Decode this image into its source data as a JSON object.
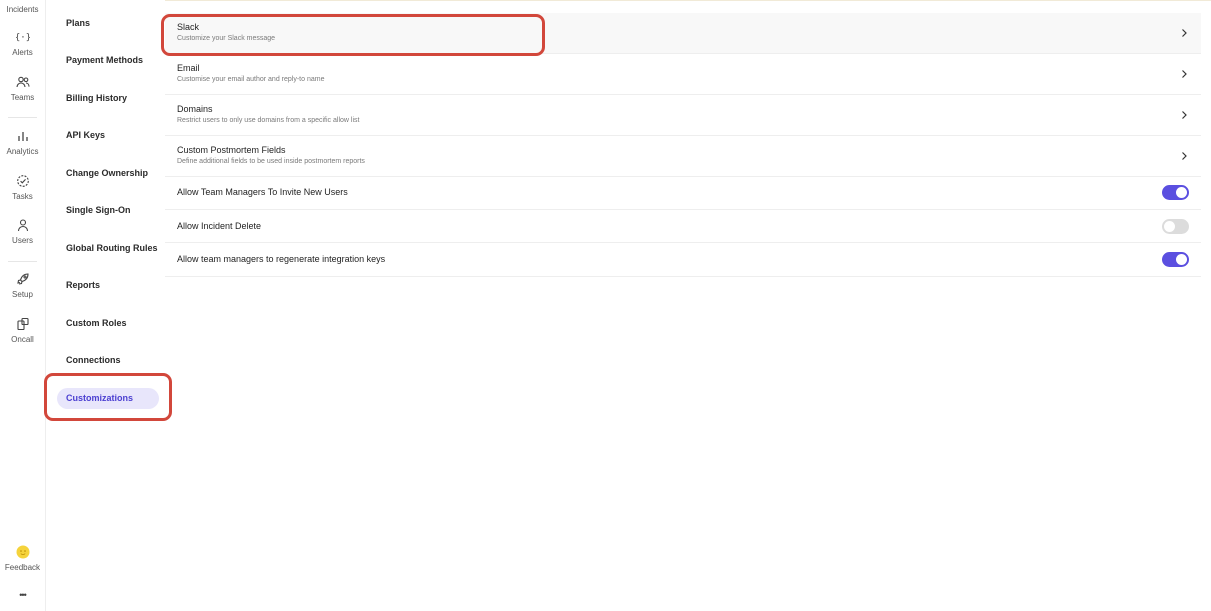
{
  "rail": {
    "items": [
      {
        "label": "Incidents",
        "icon": "incidents-icon"
      },
      {
        "label": "Alerts",
        "icon": "alerts-icon"
      },
      {
        "label": "Teams",
        "icon": "teams-icon"
      },
      {
        "label": "Analytics",
        "icon": "analytics-icon"
      },
      {
        "label": "Tasks",
        "icon": "tasks-icon"
      },
      {
        "label": "Users",
        "icon": "user-icon"
      },
      {
        "label": "Setup",
        "icon": "rocket-icon"
      },
      {
        "label": "Oncall",
        "icon": "oncall-icon"
      }
    ],
    "feedback_label": "Feedback",
    "more_label": "•••"
  },
  "nav": {
    "items": [
      {
        "label": "Plans"
      },
      {
        "label": "Payment Methods"
      },
      {
        "label": "Billing History"
      },
      {
        "label": "API Keys"
      },
      {
        "label": "Change Ownership"
      },
      {
        "label": "Single Sign-On"
      },
      {
        "label": "Global Routing Rules"
      },
      {
        "label": "Reports"
      },
      {
        "label": "Custom Roles"
      },
      {
        "label": "Connections"
      },
      {
        "label": "Customizations",
        "active": true
      }
    ]
  },
  "main": {
    "rows": [
      {
        "title": "Slack",
        "subtitle": "Customize your Slack message",
        "control": "chevron"
      },
      {
        "title": "Email",
        "subtitle": "Customise your email author and reply-to name",
        "control": "chevron"
      },
      {
        "title": "Domains",
        "subtitle": "Restrict users to only use domains from a specific allow list",
        "control": "chevron"
      },
      {
        "title": "Custom Postmortem Fields",
        "subtitle": "Define additional fields to be used inside postmortem reports",
        "control": "chevron"
      },
      {
        "title": "Allow Team Managers To Invite New Users",
        "control": "toggle",
        "on": true
      },
      {
        "title": "Allow Incident Delete",
        "control": "toggle",
        "on": false
      },
      {
        "title": "Allow team managers to regenerate integration keys",
        "control": "toggle",
        "on": true
      }
    ]
  },
  "colors": {
    "accent": "#5b4fe0",
    "active_nav_bg": "#e8e6fb",
    "highlight": "#d2473b",
    "feedback_dot": "#f5d33b"
  }
}
